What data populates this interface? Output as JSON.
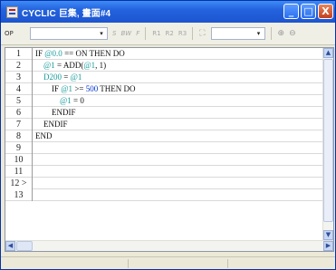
{
  "window": {
    "title": "CYCLIC 巨集, 畫面#4",
    "minimize_glyph": "_",
    "maximize_glyph": "□",
    "close_glyph": "X"
  },
  "toolbar": {
    "label": "OP",
    "combo_arrow": "▾",
    "bold_btn": "S",
    "bw_btn": "BW",
    "f_btn": "F",
    "r1_btn": "R1",
    "r2_btn": "R2",
    "r3_btn": "R3",
    "tool_icon": "⛶",
    "zoom_in_icon": "⊕",
    "zoom_out_icon": "⊖"
  },
  "editor": {
    "lines": [
      {
        "num": "1",
        "indent": "",
        "parts": [
          {
            "t": "IF ",
            "c": ""
          },
          {
            "t": "@0.0",
            "c": "var"
          },
          {
            "t": " == ON THEN DO",
            "c": ""
          }
        ]
      },
      {
        "num": "2",
        "indent": "    ",
        "parts": [
          {
            "t": "@1",
            "c": "var"
          },
          {
            "t": " = ADD(",
            "c": ""
          },
          {
            "t": "@1",
            "c": "var"
          },
          {
            "t": ", 1)",
            "c": ""
          }
        ]
      },
      {
        "num": "3",
        "indent": "    ",
        "parts": [
          {
            "t": "D200",
            "c": "var"
          },
          {
            "t": " = ",
            "c": ""
          },
          {
            "t": "@1",
            "c": "var"
          }
        ]
      },
      {
        "num": "4",
        "indent": "        ",
        "parts": [
          {
            "t": "IF ",
            "c": ""
          },
          {
            "t": "@1",
            "c": "var"
          },
          {
            "t": " >= ",
            "c": ""
          },
          {
            "t": "500",
            "c": "num"
          },
          {
            "t": " THEN DO",
            "c": ""
          }
        ]
      },
      {
        "num": "5",
        "indent": "            ",
        "parts": [
          {
            "t": "@1",
            "c": "var"
          },
          {
            "t": " = 0",
            "c": ""
          }
        ]
      },
      {
        "num": "6",
        "indent": "        ",
        "parts": [
          {
            "t": "ENDIF",
            "c": ""
          }
        ]
      },
      {
        "num": "7",
        "indent": "    ",
        "parts": [
          {
            "t": "ENDIF",
            "c": ""
          }
        ]
      },
      {
        "num": "8",
        "indent": "",
        "parts": [
          {
            "t": "END",
            "c": ""
          }
        ]
      },
      {
        "num": "9",
        "indent": "",
        "parts": []
      },
      {
        "num": "10",
        "indent": "",
        "parts": []
      },
      {
        "num": "11",
        "indent": "",
        "parts": []
      },
      {
        "num": "12 >",
        "indent": "",
        "parts": [],
        "active": true
      },
      {
        "num": "13",
        "indent": "",
        "parts": []
      }
    ]
  },
  "scrollbars": {
    "up": "▲",
    "down": "▼",
    "left": "◀",
    "right": "▶"
  },
  "colors": {
    "variable": "#1a9a9a",
    "number": "#0033cc",
    "titlebar": "#2463de"
  }
}
